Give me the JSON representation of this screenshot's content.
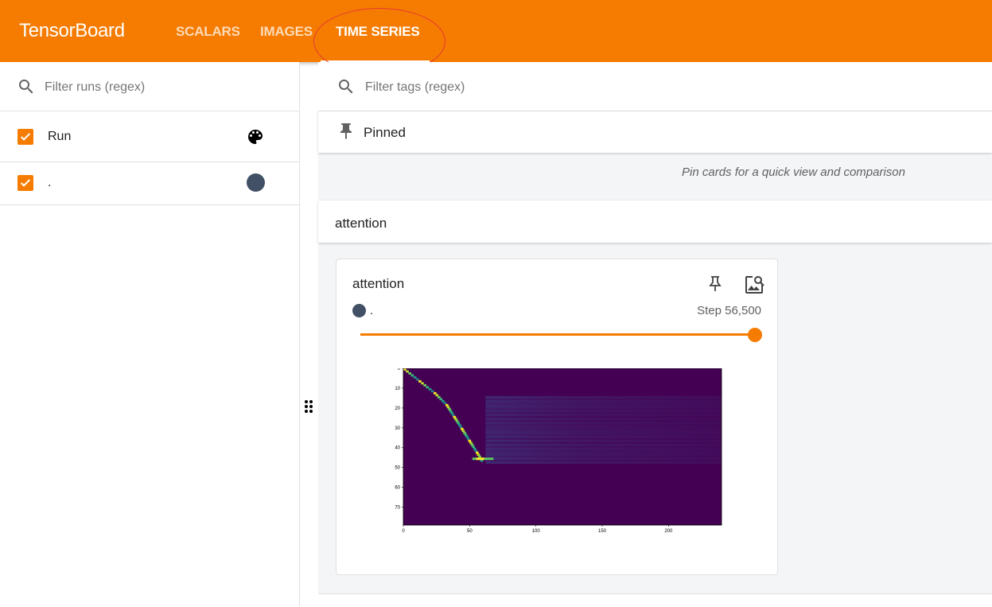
{
  "app": {
    "title": "TensorBoard"
  },
  "nav": {
    "tabs": [
      {
        "label": "SCALARS",
        "active": false
      },
      {
        "label": "IMAGES",
        "active": false
      },
      {
        "label": "TIME SERIES",
        "active": true
      }
    ]
  },
  "sidebar": {
    "search_placeholder": "Filter runs (regex)",
    "runs": [
      {
        "label": "Run",
        "checked": true,
        "icon": "palette-icon"
      },
      {
        "label": ".",
        "checked": true,
        "color": "#425066"
      }
    ]
  },
  "main": {
    "search_placeholder": "Filter tags (regex)",
    "pinned": {
      "title": "Pinned",
      "empty_message": "Pin cards for a quick view and comparison"
    },
    "group": {
      "title": "attention"
    },
    "card": {
      "title": "attention",
      "run_name": ".",
      "run_color": "#425066",
      "step_text": "Step 56,500",
      "slider_fraction": 1.0
    }
  },
  "chart_data": {
    "type": "heatmap",
    "x_ticks": [
      "0",
      "50",
      "100",
      "150",
      "200"
    ],
    "y_ticks": [
      "0",
      "10",
      "20",
      "30",
      "40",
      "50",
      "60",
      "70"
    ],
    "colormap": "viridis",
    "background_color": "#440154"
  },
  "colors": {
    "accent": "#f57c00",
    "run_color": "#425066"
  }
}
